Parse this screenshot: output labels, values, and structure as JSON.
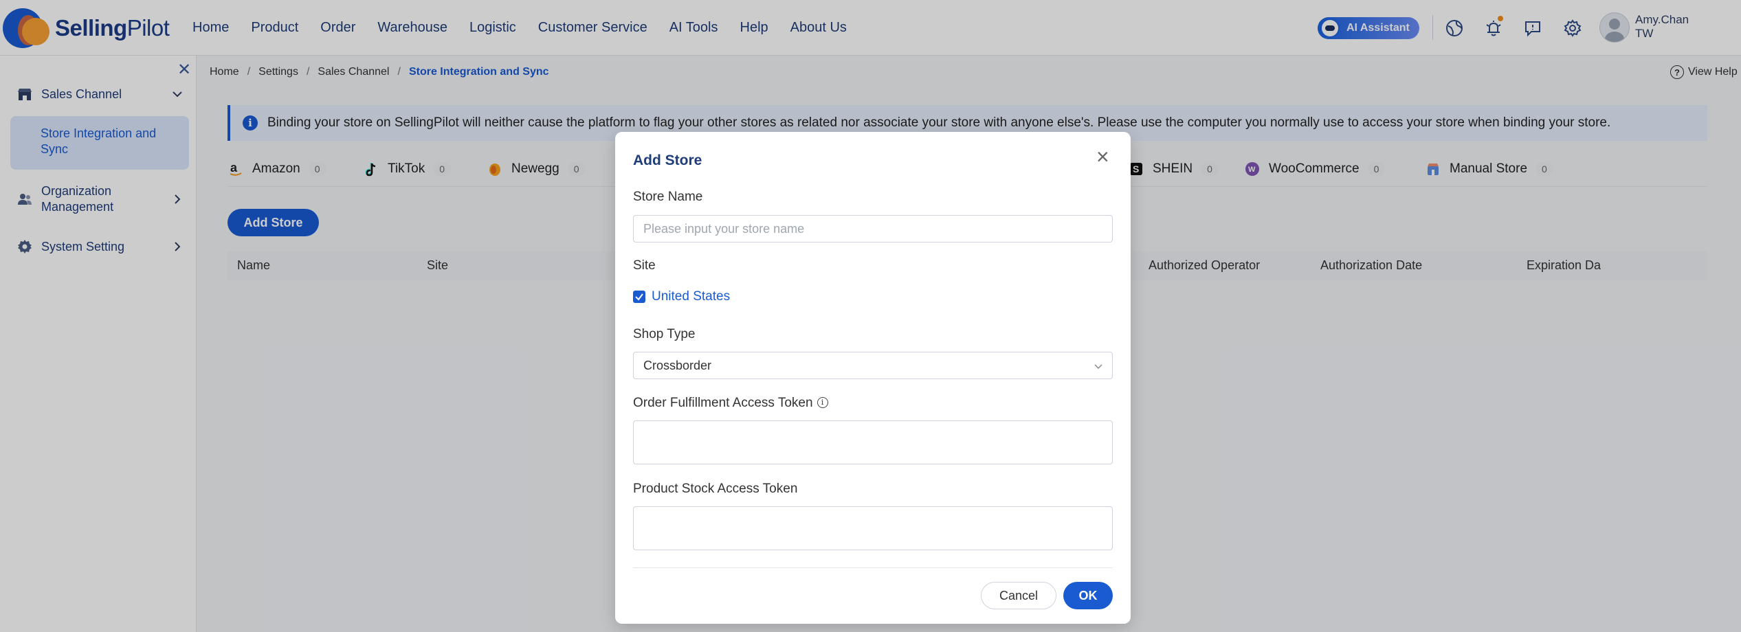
{
  "app": {
    "name_bold": "Selling",
    "name_rest": "Pilot"
  },
  "nav": [
    "Home",
    "Product",
    "Order",
    "Warehouse",
    "Logistic",
    "Customer Service",
    "AI Tools",
    "Help",
    "About Us"
  ],
  "header": {
    "ai_assistant": "AI Assistant",
    "icons": [
      "globe-icon",
      "bell-icon",
      "message-icon",
      "settings-icon"
    ],
    "user": {
      "name": "Amy.Chan",
      "region": "TW"
    }
  },
  "sidebar": {
    "groups": [
      {
        "label": "Sales Channel",
        "icon": "store-icon",
        "expanded": true
      },
      {
        "label": "Organization Management",
        "icon": "users-icon",
        "expanded": false
      },
      {
        "label": "System Setting",
        "icon": "gear-icon",
        "expanded": false
      }
    ],
    "active_item": "Store Integration and Sync"
  },
  "breadcrumb": [
    "Home",
    "Settings",
    "Sales Channel",
    "Store Integration and Sync"
  ],
  "view_help": "View Help",
  "notice": "Binding your store on SellingPilot will neither cause the platform to flag your other stores as related nor associate your store with anyone else's. Please use the computer you normally use to access your store when binding your store.",
  "tabs": [
    {
      "label": "Amazon",
      "count": "0",
      "icon": "amazon-icon"
    },
    {
      "label": "TikTok",
      "count": "0",
      "icon": "tiktok-icon"
    },
    {
      "label": "Newegg",
      "count": "0",
      "icon": "newegg-icon"
    },
    {
      "label": "SHEIN",
      "count": "0",
      "icon": "shein-icon"
    },
    {
      "label": "WooCommerce",
      "count": "0",
      "icon": "woocommerce-icon"
    },
    {
      "label": "Manual Store",
      "count": "0",
      "icon": "manual-store-icon"
    }
  ],
  "add_store_button": "Add Store",
  "table": {
    "columns": [
      "Name",
      "Site",
      "Authorized Operator",
      "Authorization Date",
      "Expiration Da"
    ]
  },
  "modal": {
    "title": "Add Store",
    "store_name_label": "Store Name",
    "store_name_placeholder": "Please input your store name",
    "site_label": "Site",
    "site_option": "United States",
    "site_checked": true,
    "shop_type_label": "Shop Type",
    "shop_type_value": "Crossborder",
    "order_token_label": "Order Fulfillment Access Token",
    "stock_token_label": "Product Stock Access Token",
    "cancel": "Cancel",
    "ok": "OK"
  },
  "colors": {
    "primary": "#1a5bd2",
    "brand_orange": "#f7a134",
    "nav_text": "#1f3d7a"
  }
}
